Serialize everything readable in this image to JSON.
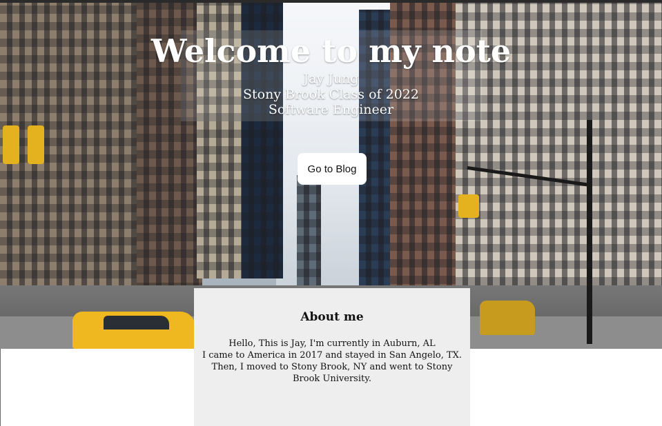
{
  "hero": {
    "title": "Welcome to my note",
    "name": "Jay Jung",
    "school": "Stony Brook Class of 2022",
    "role": "Software Engineer",
    "button_label": "Go to Blog"
  },
  "about": {
    "heading": "About me",
    "lines": [
      "Hello, This is Jay, I'm currently in Auburn, AL",
      "I came to America in 2017 and stayed in San Angelo, TX. Then, I moved to Stony Brook, NY and went to Stony Brook University."
    ]
  },
  "colors": {
    "about_background": "#eeeeee",
    "button_background": "#ffffff",
    "hero_text": "#ffffff"
  }
}
